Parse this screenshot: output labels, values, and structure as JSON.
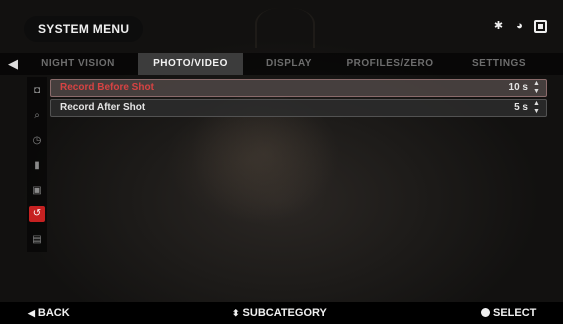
{
  "header": {
    "title": "SYSTEM MENU",
    "status_icons": [
      "bluetooth-icon",
      "wifi-icon",
      "battery-icon"
    ]
  },
  "tabs": [
    {
      "label": "NIGHT VISION",
      "active": false
    },
    {
      "label": "PHOTO/VIDEO",
      "active": true
    },
    {
      "label": "DISPLAY",
      "active": false
    },
    {
      "label": "PROFILES/ZERO",
      "active": false
    },
    {
      "label": "SETTINGS",
      "active": false
    }
  ],
  "sidebar": {
    "items": [
      "camera-icon",
      "search-icon",
      "timer-icon",
      "microphone-icon",
      "video-icon",
      "record-icon",
      "storage-icon"
    ],
    "active_index": 5
  },
  "settings": [
    {
      "label": "Record Before Shot",
      "value": "10 s",
      "selected": true
    },
    {
      "label": "Record After Shot",
      "value": "5 s",
      "selected": false
    }
  ],
  "footer": {
    "back": "BACK",
    "subcategory": "SUBCATEGORY",
    "select": "SELECT"
  },
  "colors": {
    "accent": "#c62121",
    "selected_text": "#d74343"
  }
}
